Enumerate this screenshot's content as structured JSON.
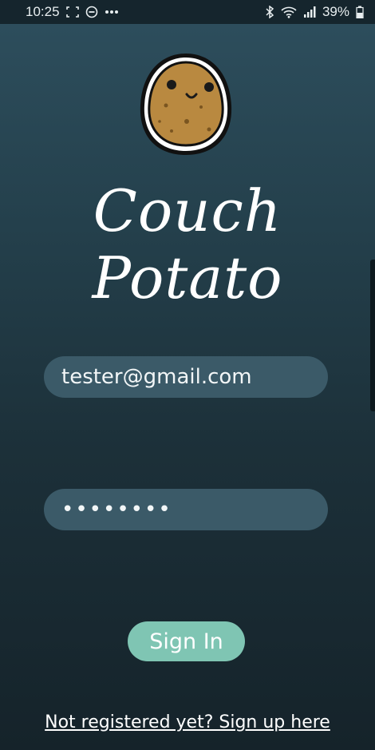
{
  "status_bar": {
    "time": "10:25",
    "left_icons": [
      "screenshot-icon",
      "do-not-disturb-icon",
      "more-icon"
    ],
    "right_icons": [
      "bluetooth-icon",
      "wifi-icon",
      "signal-icon"
    ],
    "battery": "39%"
  },
  "app": {
    "title": "Couch Potato",
    "logo": "potato-logo-icon"
  },
  "form": {
    "email_value": "tester@gmail.com",
    "password_value": "••••••••",
    "signin_label": "Sign In",
    "signup_link": "Not registered yet? Sign up here"
  },
  "colors": {
    "background_top": "#2e4f5e",
    "background_bottom": "#15232a",
    "field_bg": "#3b5a68",
    "button_bg": "#7fc5b3"
  }
}
